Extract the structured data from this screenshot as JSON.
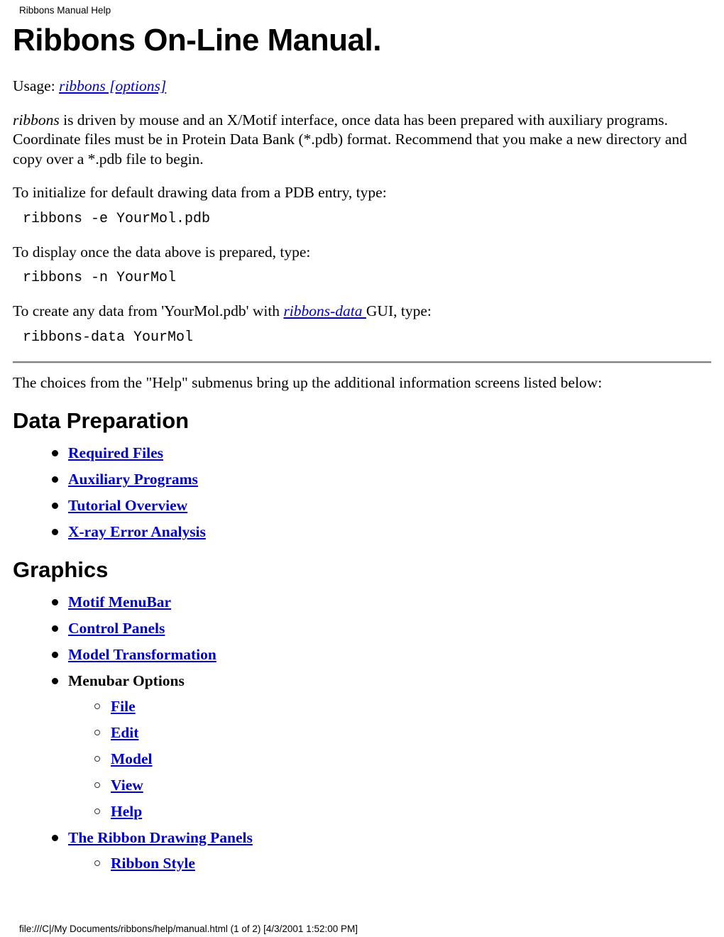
{
  "header": {
    "running_head": "Ribbons Manual Help"
  },
  "title": "Ribbons On-Line Manual.",
  "usage": {
    "label": "Usage:",
    "link_text": "ribbons [options]"
  },
  "intro": {
    "emphasis": "ribbons",
    "text": " is driven by mouse and an X/Motif interface, once data has been prepared with auxiliary programs. Coordinate files must be in Protein Data Bank (*.pdb) format. Recommend that you make a new directory and copy over a *.pdb file to begin."
  },
  "steps": [
    {
      "prompt": "To initialize for default drawing data from a PDB entry, type:",
      "command": "ribbons -e YourMol.pdb"
    },
    {
      "prompt": "To display once the data above is prepared, type:",
      "command": "ribbons -n YourMol"
    }
  ],
  "gui_step": {
    "prefix": "To create any data from 'YourMol.pdb' with ",
    "link_text": "ribbons-data ",
    "suffix": "GUI, type:",
    "command": "ribbons-data YourMol"
  },
  "help_note": "The choices from the \"Help\" submenus bring up the additional information screens listed below:",
  "sections": [
    {
      "heading": "Data Preparation",
      "items": [
        {
          "label": "Required Files",
          "link": true
        },
        {
          "label": "Auxiliary Programs",
          "link": true
        },
        {
          "label": "Tutorial Overview",
          "link": true
        },
        {
          "label": "X-ray Error Analysis",
          "link": true
        }
      ]
    },
    {
      "heading": "Graphics",
      "items": [
        {
          "label": "Motif MenuBar",
          "link": true
        },
        {
          "label": "Control Panels",
          "link": true
        },
        {
          "label": "Model Transformation",
          "link": true
        },
        {
          "label": "Menubar Options",
          "link": false,
          "children": [
            {
              "label": "File",
              "link": true
            },
            {
              "label": "Edit",
              "link": true
            },
            {
              "label": "Model",
              "link": true
            },
            {
              "label": "View",
              "link": true
            },
            {
              "label": "Help",
              "link": true
            }
          ]
        },
        {
          "label": "The Ribbon Drawing Panels",
          "link": true,
          "children": [
            {
              "label": "Ribbon Style",
              "link": true
            }
          ]
        }
      ]
    }
  ],
  "footer": {
    "path_line": "file:///C|/My Documents/ribbons/help/manual.html (1 of 2) [4/3/2001 1:52:00 PM]"
  },
  "colors": {
    "link": "#0000CC",
    "text": "#000000",
    "rule_dark": "#808080",
    "rule_light": "#d4d4d4",
    "background": "#ffffff"
  }
}
